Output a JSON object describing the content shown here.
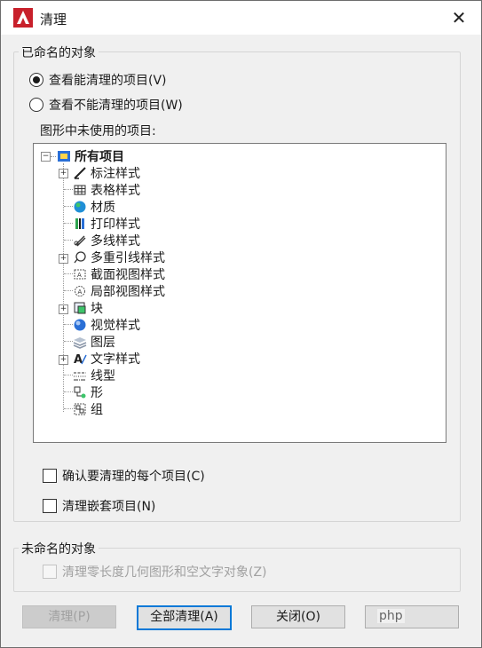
{
  "window": {
    "title": "清理"
  },
  "named": {
    "group_label": "已命名的对象",
    "radio_can": "查看能清理的项目(V)",
    "radio_cannot": "查看不能清理的项目(W)",
    "tree_label": "图形中未使用的项目:"
  },
  "tree": {
    "root": "所有项目",
    "items": [
      "标注样式",
      "表格样式",
      "材质",
      "打印样式",
      "多线样式",
      "多重引线样式",
      "截面视图样式",
      "局部视图样式",
      "块",
      "视觉样式",
      "图层",
      "文字样式",
      "线型",
      "形",
      "组"
    ]
  },
  "options": {
    "confirm": "确认要清理的每个项目(C)",
    "nested": "清理嵌套项目(N)"
  },
  "unnamed": {
    "group_label": "未命名的对象",
    "zero_length": "清理零长度几何图形和空文字对象(Z)"
  },
  "buttons": {
    "purge": "清理(P)",
    "purge_all": "全部清理(A)",
    "close": "关闭(O)"
  },
  "watermark": "php",
  "colors": {
    "accent": "#0078d7",
    "app_red": "#c8202b"
  }
}
